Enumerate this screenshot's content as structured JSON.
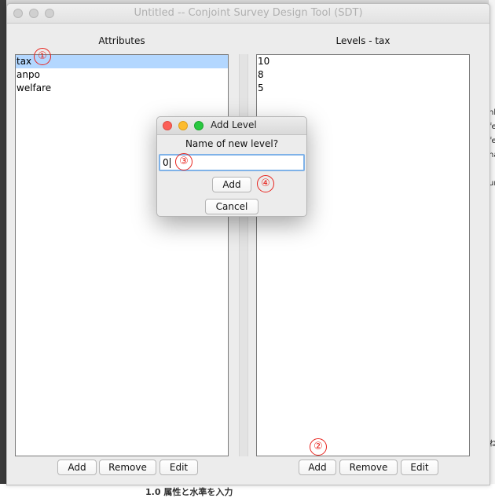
{
  "window": {
    "title": "Untitled -- Conjoint Survey Design Tool (SDT)"
  },
  "attributes_panel": {
    "label": "Attributes",
    "items": [
      {
        "label": "tax",
        "selected": true
      },
      {
        "label": "anpo",
        "selected": false
      },
      {
        "label": "welfare",
        "selected": false
      }
    ],
    "buttons": {
      "add": "Add",
      "remove": "Remove",
      "edit": "Edit"
    }
  },
  "levels_panel": {
    "label": "Levels - tax",
    "items": [
      "10",
      "8",
      "5"
    ],
    "buttons": {
      "add": "Add",
      "remove": "Remove",
      "edit": "Edit"
    }
  },
  "dialog": {
    "title": "Add Level",
    "prompt": "Name of new level?",
    "input_value": "0",
    "add_label": "Add",
    "cancel_label": "Cancel"
  },
  "annotations": [
    "①",
    "②",
    "③",
    "④"
  ],
  "background": {
    "right_snippets": [
      "nk",
      "fe",
      "fe",
      "na",
      "ur",
      "ね"
    ],
    "bottom_text": "1.0 属性と水準を入力"
  },
  "colors": {
    "selection": "#b3d7ff",
    "annotation_red": "#e8251f",
    "focus_ring": "#7fb2e8",
    "close": "#fc5f57",
    "minimize": "#fdbc2e",
    "maximize": "#29c840"
  }
}
